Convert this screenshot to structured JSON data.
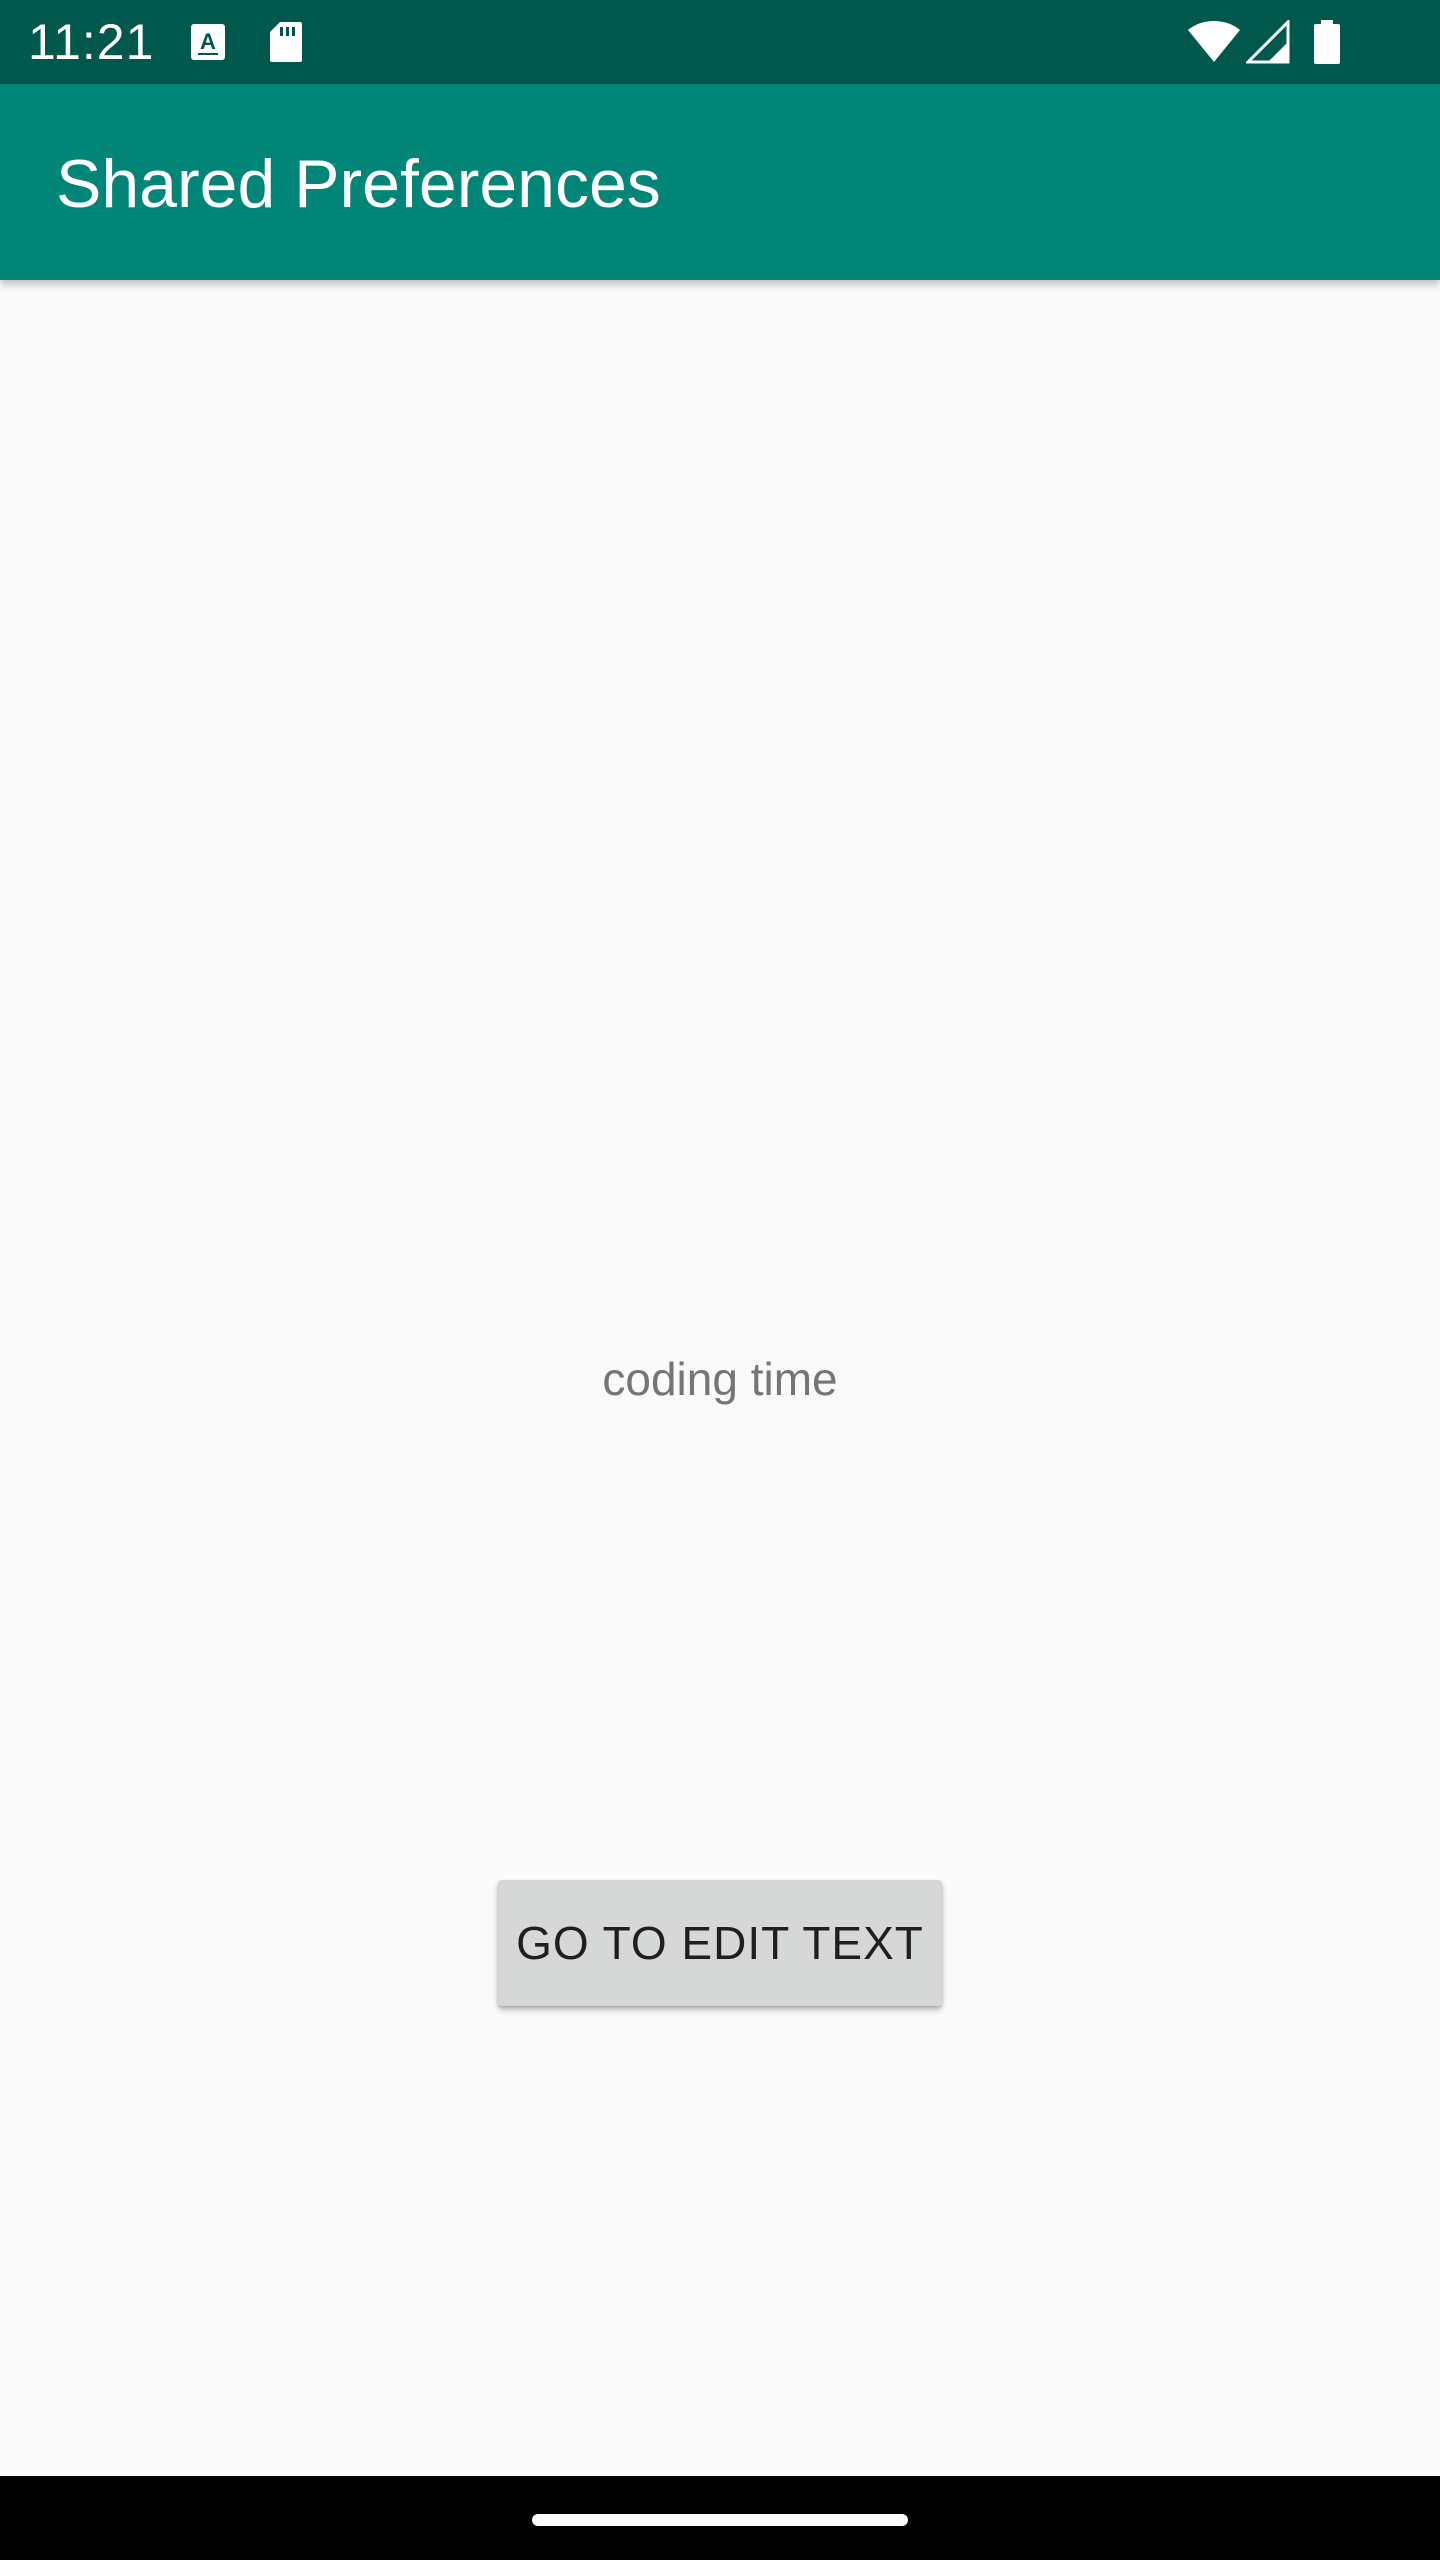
{
  "status_bar": {
    "time": "11:21",
    "background": "#00574b",
    "left_icons": [
      "font-download-icon",
      "sd-card-icon"
    ],
    "right_icons": [
      "wifi-icon",
      "cellular-signal-icon",
      "battery-icon"
    ]
  },
  "app_bar": {
    "title": "Shared Preferences",
    "background": "#008577"
  },
  "main": {
    "text": "coding time",
    "button_label": "GO TO EDIT TEXT"
  },
  "nav_bar": {
    "background": "#000000",
    "handle": "home-gesture-handle"
  }
}
